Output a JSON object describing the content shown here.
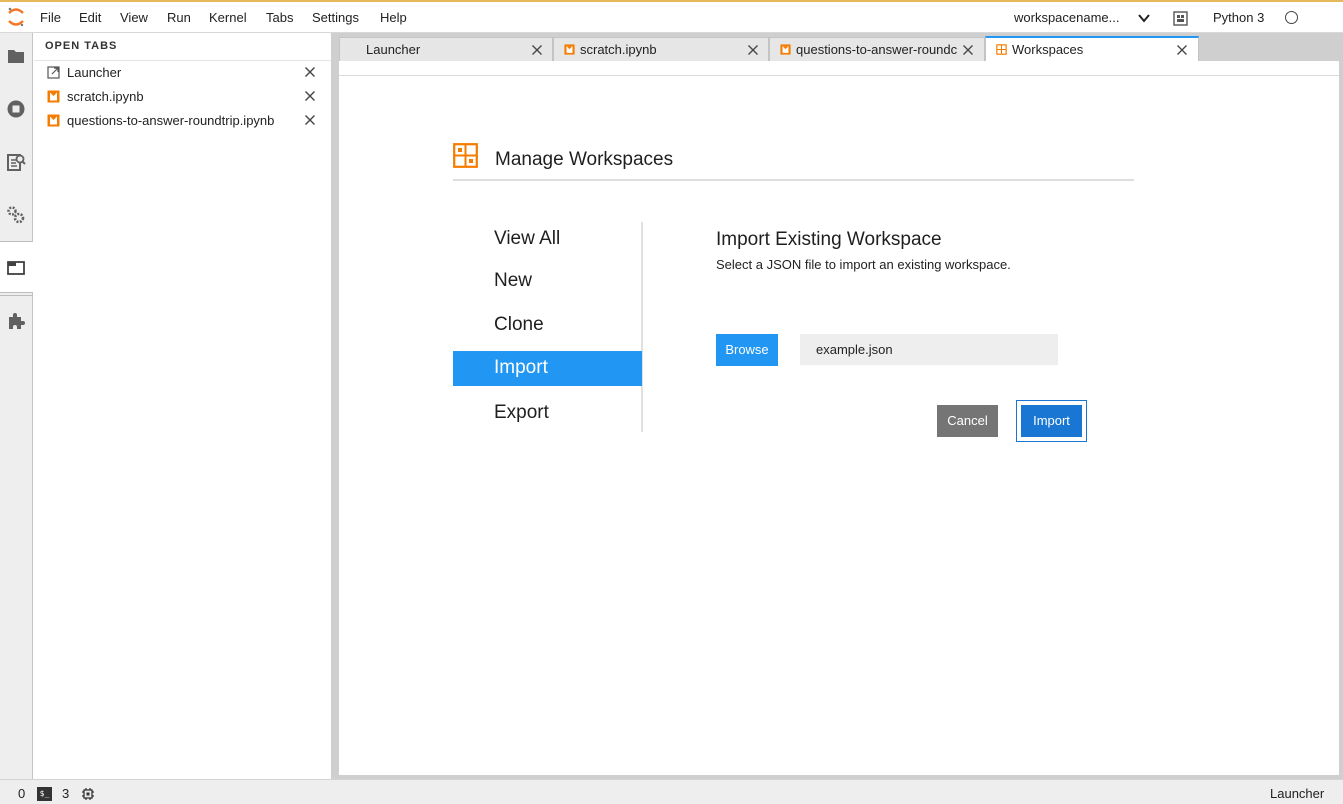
{
  "menubar": {
    "items": [
      "File",
      "Edit",
      "View",
      "Run",
      "Kernel",
      "Tabs",
      "Settings",
      "Help"
    ],
    "workspace_name": "workspacename...",
    "kernel_name": "Python 3",
    "kernel_status": "idle"
  },
  "activitybar": {
    "icons": [
      "folder-icon",
      "running-icon",
      "command-palette-icon",
      "property-inspector-icon",
      "tabs-icon",
      "extension-icon"
    ],
    "active": "tabs-icon"
  },
  "sidepanel": {
    "title": "OPEN TABS",
    "tabs": [
      {
        "label": "Launcher",
        "icon": "launcher-icon"
      },
      {
        "label": "scratch.ipynb",
        "icon": "notebook-icon"
      },
      {
        "label": "questions-to-answer-roundtrip.ipynb",
        "icon": "notebook-icon"
      }
    ]
  },
  "doc_tabs": [
    {
      "label": "Launcher",
      "icon": "none",
      "active": false
    },
    {
      "label": "scratch.ipynb",
      "icon": "notebook-icon",
      "active": false
    },
    {
      "label": "questions-to-answer-roundc",
      "icon": "notebook-icon",
      "active": false
    },
    {
      "label": "Workspaces",
      "icon": "workspaces-icon",
      "active": true
    }
  ],
  "workspaces": {
    "title": "Manage Workspaces",
    "nav": [
      "View All",
      "New",
      "Clone",
      "Import",
      "Export"
    ],
    "nav_active": "Import",
    "import": {
      "heading": "Import Existing Workspace",
      "description": "Select a JSON file to import an existing workspace.",
      "browse_label": "Browse",
      "file_value": "example.json",
      "cancel_label": "Cancel",
      "import_label": "Import"
    }
  },
  "statusbar": {
    "kernels_count": "0",
    "terminals_count": "3",
    "current_activity": "Launcher"
  },
  "colors": {
    "accent": "#2196f3",
    "notebook_orange": "#f57c00",
    "cancel_grey": "#757575"
  }
}
